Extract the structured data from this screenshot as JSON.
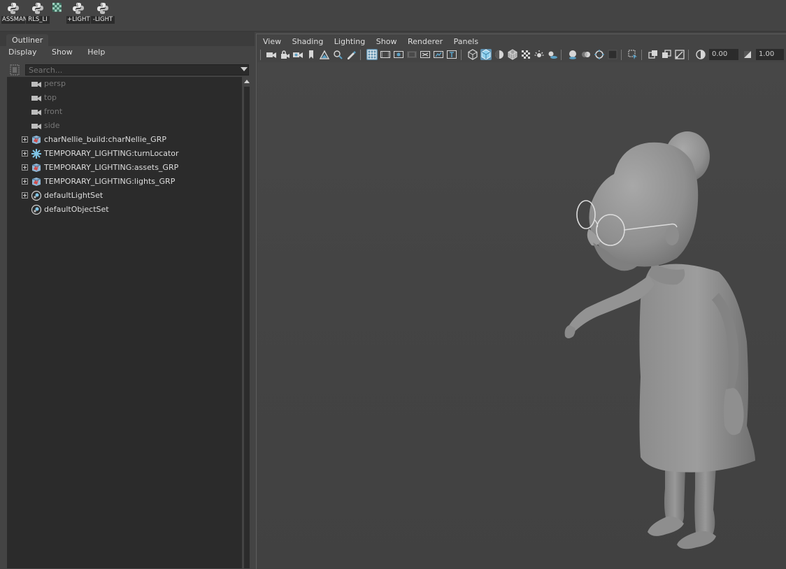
{
  "shelf": {
    "items": [
      {
        "label": "ASSMAN",
        "icon": "python-script-icon"
      },
      {
        "label": "RLS_LI",
        "icon": "python-script-icon"
      },
      {
        "label": "",
        "icon": "checker-icon"
      },
      {
        "label": "+LIGHT",
        "icon": "python-script-icon"
      },
      {
        "label": "-LIGHT",
        "icon": "python-script-icon"
      }
    ]
  },
  "outliner": {
    "tab_label": "Outliner",
    "menus": [
      "Display",
      "Show",
      "Help"
    ],
    "search_placeholder": "Search...",
    "items": [
      {
        "label": "persp",
        "icon": "camera-icon",
        "expandable": false,
        "dim": true
      },
      {
        "label": "top",
        "icon": "camera-icon",
        "expandable": false,
        "dim": true
      },
      {
        "label": "front",
        "icon": "camera-icon",
        "expandable": false,
        "dim": true
      },
      {
        "label": "side",
        "icon": "camera-icon",
        "expandable": false,
        "dim": true
      },
      {
        "label": "charNellie_build:charNellie_GRP",
        "icon": "group-icon",
        "expandable": true,
        "dim": false
      },
      {
        "label": "TEMPORARY_LIGHTING:turnLocator",
        "icon": "locator-icon",
        "expandable": true,
        "dim": false
      },
      {
        "label": "TEMPORARY_LIGHTING:assets_GRP",
        "icon": "group-icon",
        "expandable": true,
        "dim": false
      },
      {
        "label": "TEMPORARY_LIGHTING:lights_GRP",
        "icon": "group-icon",
        "expandable": true,
        "dim": false
      },
      {
        "label": "defaultLightSet",
        "icon": "set-icon",
        "expandable": true,
        "dim": false
      },
      {
        "label": "defaultObjectSet",
        "icon": "set-icon",
        "expandable": false,
        "dim": false
      }
    ]
  },
  "viewport": {
    "menus": [
      "View",
      "Shading",
      "Lighting",
      "Show",
      "Renderer",
      "Panels"
    ],
    "exposure": "0.00",
    "gamma": "1.00"
  },
  "colors": {
    "accent": "#5d8fae",
    "panel": "#444444",
    "field": "#2b2b2b"
  }
}
